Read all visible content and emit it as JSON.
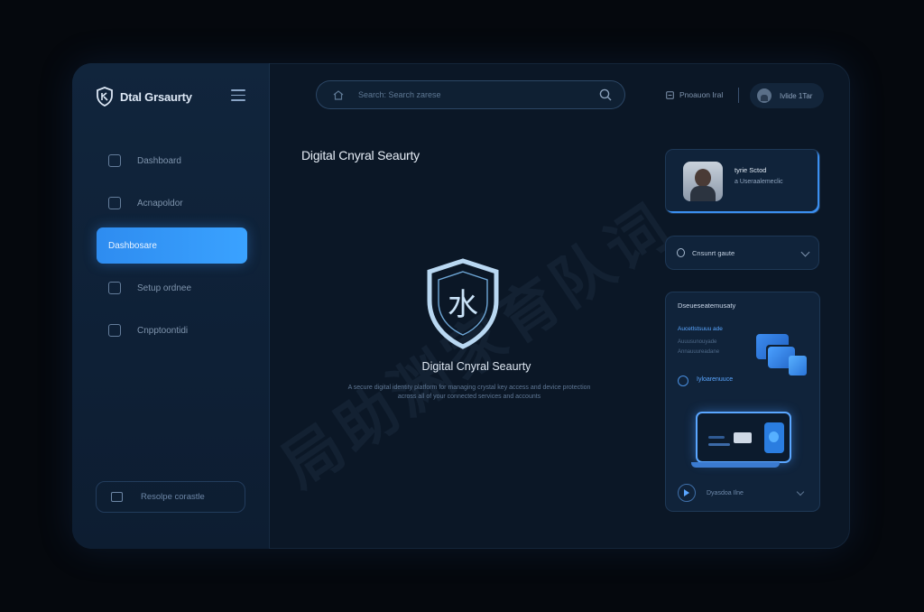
{
  "app": {
    "brand": "Dtal Grsaurty",
    "page_title": "Digital Cnyral Seaurty",
    "center_title": "Digital Cnyral Seaurty",
    "center_logo_glyph": "水",
    "center_description": "A secure digital identity platform for managing crystal key access and device protection across all of your connected services and accounts",
    "watermark": "局助渊家育队词"
  },
  "sidebar": {
    "items": [
      {
        "label": "Dashboard",
        "active": false
      },
      {
        "label": "Acnapoldor",
        "active": false
      },
      {
        "label": "Dashbosare",
        "active": true
      },
      {
        "label": "Setup ordnee",
        "active": false
      },
      {
        "label": "Cnpptoontidi",
        "active": false
      }
    ],
    "footer_label": "Resolpe corastle"
  },
  "header": {
    "search_placeholder": "Search: Search zarese",
    "notifications_label": "Pnoauon  Iral",
    "profile_label": "Ivlide  1Tar"
  },
  "user_card": {
    "name": "tyrie Sctod",
    "subtitle": "a Useraalemeclic"
  },
  "select_card": {
    "label": "Cnsunrt gaute"
  },
  "detail_card": {
    "heading": "Dseueseatemusaty",
    "line1": "Aucetlstsuuu ade",
    "line2": "Auuusunouyade",
    "line3": "Annauuureadane",
    "link": "Iyloarenuuce",
    "footer": "Dyasdoa Ilne"
  },
  "colors": {
    "accent": "#2e8cf0",
    "background": "#05080d",
    "panel": "#0b1726",
    "sidebar": "#11253c"
  }
}
